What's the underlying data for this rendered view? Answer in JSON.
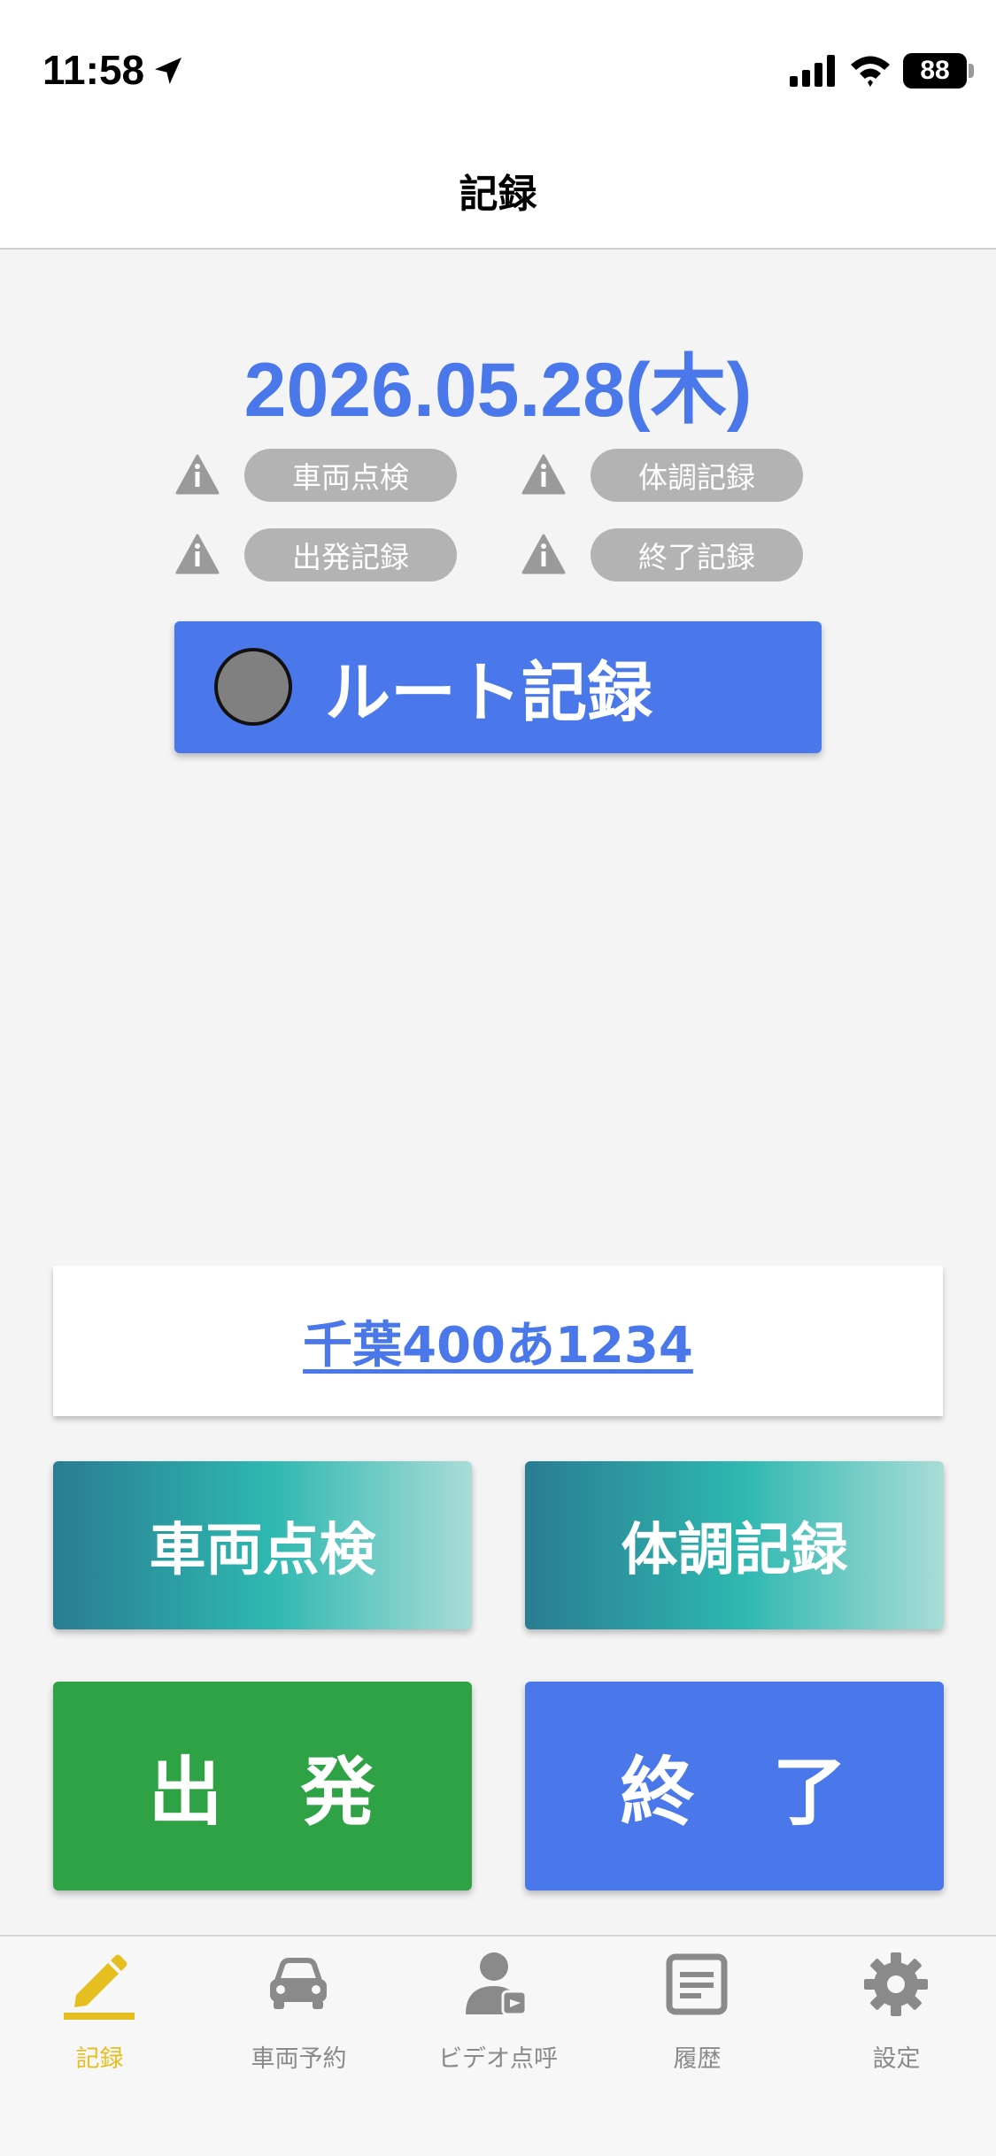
{
  "status_bar": {
    "time": "11:58",
    "battery": "88"
  },
  "header": {
    "title": "記録"
  },
  "date": "2026.05.28(木)",
  "status_items": [
    {
      "label": "車両点検"
    },
    {
      "label": "体調記録"
    },
    {
      "label": "出発記録"
    },
    {
      "label": "終了記録"
    }
  ],
  "route_button": {
    "label": "ルート記録"
  },
  "vehicle": {
    "plate": "千葉400あ1234"
  },
  "actions": {
    "vehicle_check": "車両点検",
    "health_record": "体調記録",
    "depart": "出　発",
    "finish": "終　了"
  },
  "tabs": [
    {
      "label": "記録",
      "icon": "pencil-icon",
      "active": true
    },
    {
      "label": "車両予約",
      "icon": "car-icon",
      "active": false
    },
    {
      "label": "ビデオ点呼",
      "icon": "video-call-person-icon",
      "active": false
    },
    {
      "label": "履歴",
      "icon": "history-document-icon",
      "active": false
    },
    {
      "label": "設定",
      "icon": "gear-icon",
      "active": false
    }
  ],
  "colors": {
    "accent": "#4a78ea",
    "active_tab": "#e5bf1f",
    "depart": "#2ea245",
    "inactive": "#8a8a8a"
  }
}
